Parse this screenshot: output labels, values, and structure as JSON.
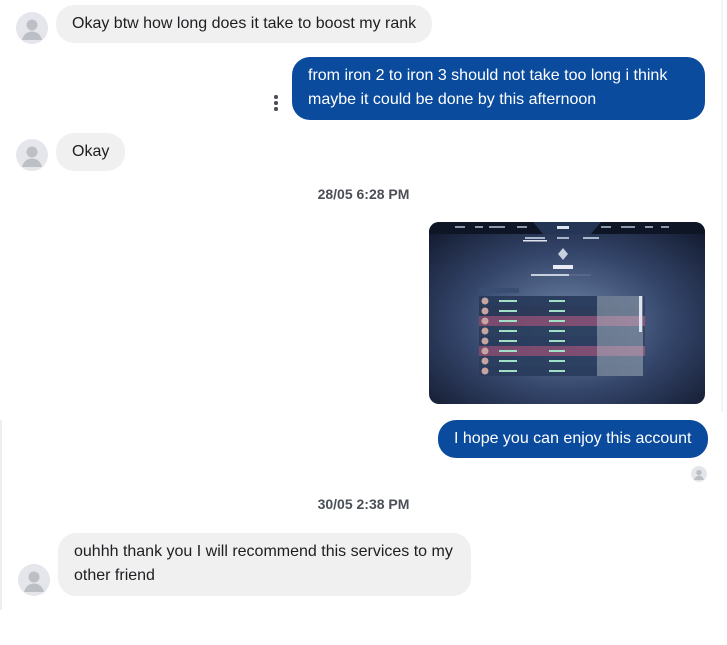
{
  "conversation": {
    "messages": [
      {
        "sender": "contact",
        "text": "Okay btw how long does it take to boost my rank"
      },
      {
        "sender": "me",
        "lines": [
          "from iron 2 to iron 3 should not take too long i think",
          "maybe  it could be done by this afternoon"
        ]
      },
      {
        "sender": "contact",
        "text": "Okay"
      },
      {
        "type": "timestamp",
        "text": "28/05  6:28 PM"
      },
      {
        "sender": "me",
        "type": "image",
        "icon": "game-rank-screenshot",
        "visible_text": "SILVER 1"
      },
      {
        "sender": "me",
        "text": "I hope you can enjoy this account"
      },
      {
        "type": "timestamp",
        "text": "30/05  2:38 PM"
      },
      {
        "sender": "contact",
        "lines": [
          "ouhhh thank you I will recommend this services to my",
          "other friend"
        ]
      }
    ]
  },
  "icons": {
    "avatar": "default-user-avatar-icon",
    "more": "more-options-icon",
    "seen": "seen-avatar-icon"
  },
  "colors": {
    "outgoing_bubble": "#0a4b9e",
    "incoming_bubble": "#f0f0f0",
    "avatar_bg": "#e4e6eb"
  }
}
